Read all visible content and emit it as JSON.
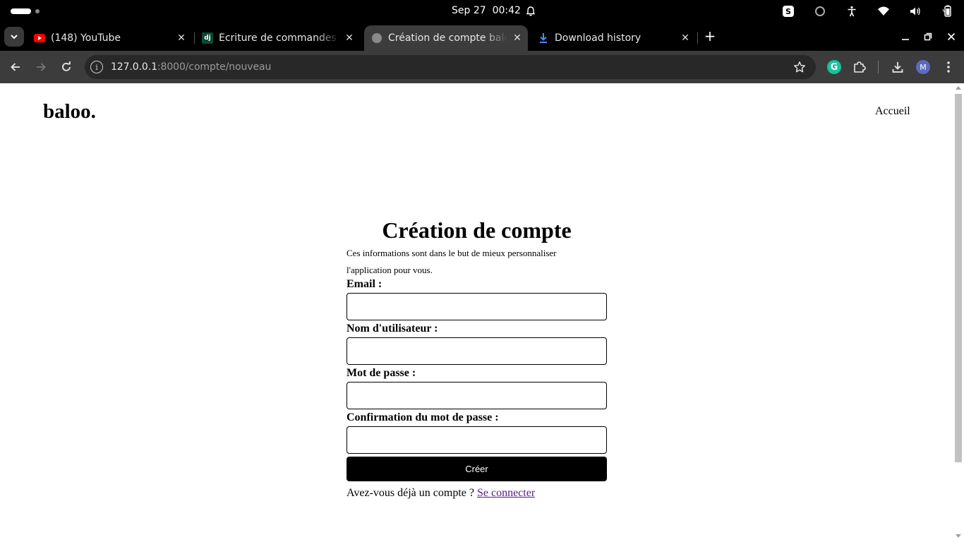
{
  "system": {
    "date": "Sep 27",
    "time": "00:42",
    "skype_badge": "S"
  },
  "tabs": [
    {
      "title": "(148) YouTube",
      "icon": "youtube-icon",
      "active": false
    },
    {
      "title": "Écriture de commandes de gestion personnalisées",
      "icon": "django-icon",
      "active": false
    },
    {
      "title": "Création de compte baloo.",
      "icon": "globe-icon",
      "active": true
    },
    {
      "title": "Download history",
      "icon": "download-icon",
      "active": false
    }
  ],
  "django_icon_text": "dj",
  "new_tab_label": "+",
  "address_bar": {
    "host": "127.0.0.1",
    "rest": ":8000/compte/nouveau"
  },
  "profile_initial": "M",
  "grammarly_letter": "G",
  "page": {
    "brand": "baloo.",
    "nav_home": "Accueil",
    "form": {
      "title": "Création de compte",
      "description": "Ces informations sont dans le but de mieux personnaliser l'application pour vous.",
      "fields": [
        {
          "label": "Email :",
          "value": ""
        },
        {
          "label": "Nom d'utilisateur :",
          "value": ""
        },
        {
          "label": "Mot de passe :",
          "value": ""
        },
        {
          "label": "Confirmation du mot de passe :",
          "value": ""
        }
      ],
      "submit_label": "Créer",
      "login_prompt": "Avez-vous déjà un compte ?",
      "login_link": "Se connecter"
    }
  },
  "colors": {
    "page_bg": "#ffffff",
    "toolbar_bg": "#3c3c3c",
    "tabstrip_bg": "#000000",
    "button_bg": "#000000",
    "link_color": "#551a8b"
  }
}
